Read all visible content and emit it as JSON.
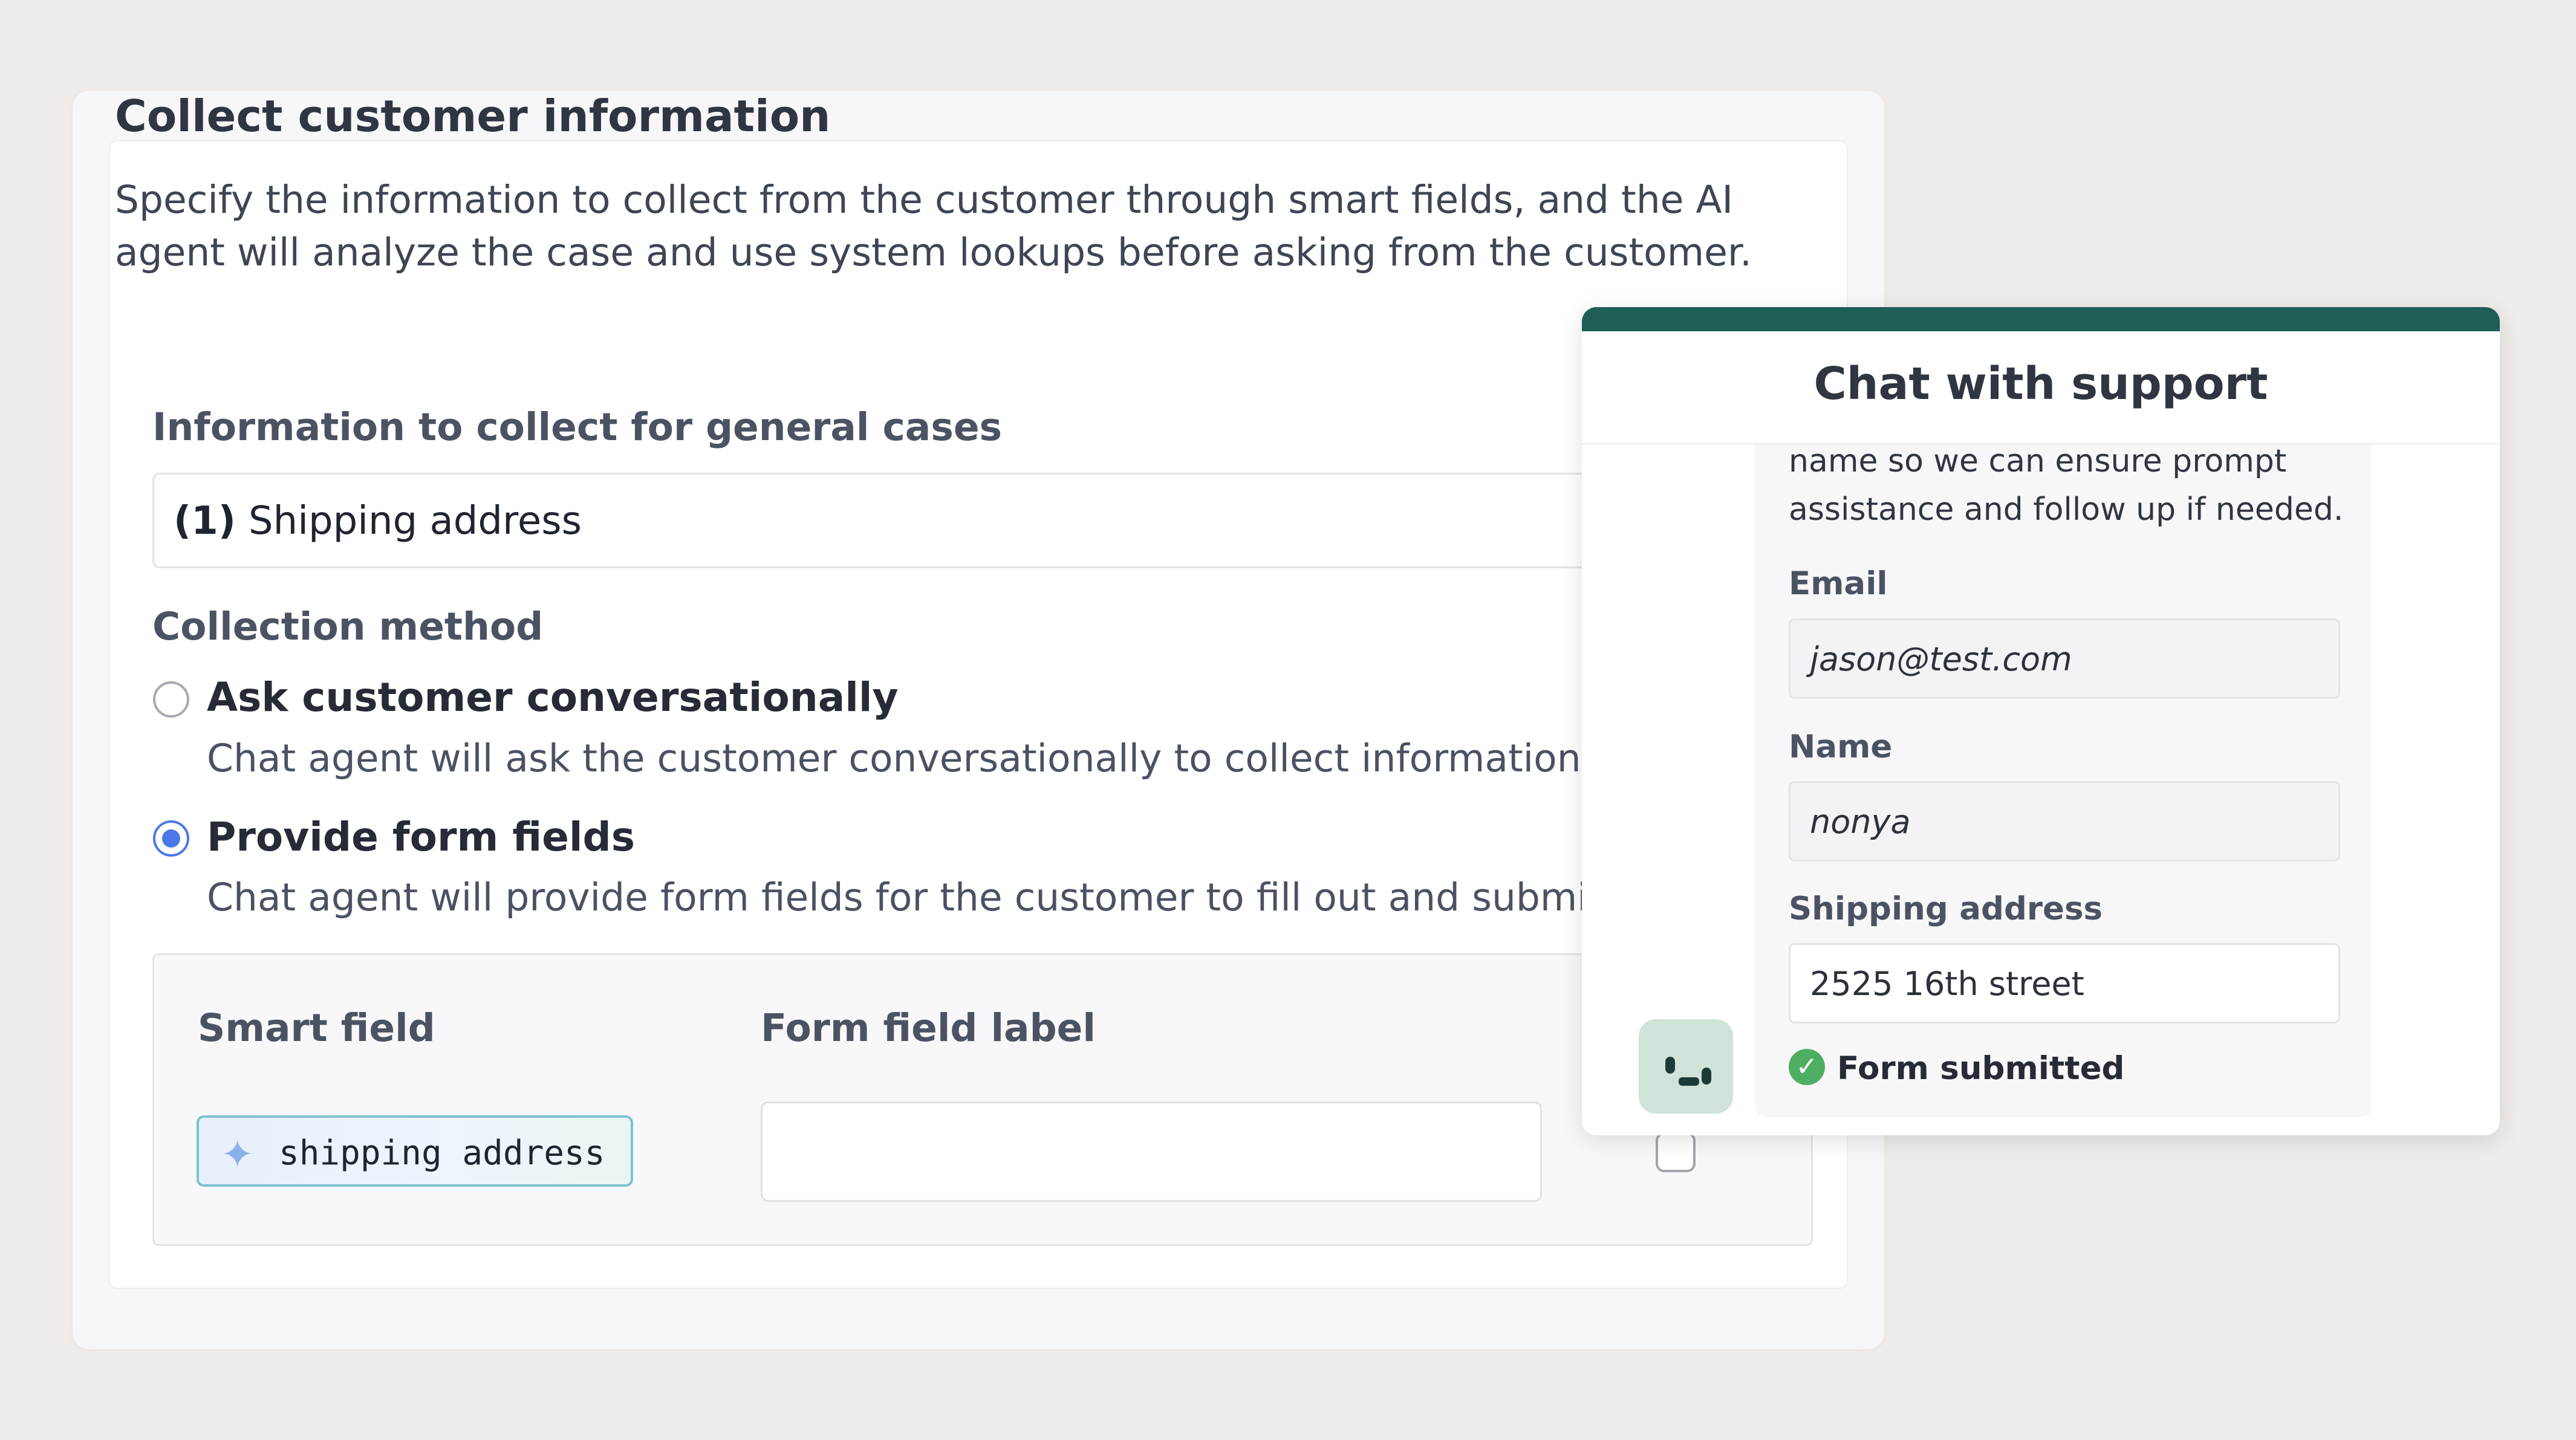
{
  "config": {
    "title": "Collect customer information",
    "description": "Specify the information to collect from the customer through smart fields, and the AI agent will analyze the case and use system lookups before asking from the customer.",
    "section_general": "Information to collect for general cases",
    "dropdown": {
      "index": "(1)",
      "value": "Shipping address"
    },
    "section_method": "Collection method",
    "options": [
      {
        "label": "Ask customer conversationally",
        "desc": "Chat agent will ask the customer conversationally to collect information.",
        "selected": false
      },
      {
        "label": "Provide form fields",
        "desc": "Chat agent will provide form fields for the customer to fill out and submit.",
        "selected": true
      }
    ],
    "table": {
      "col_smart_field": "Smart field",
      "col_form_label": "Form field label",
      "row": {
        "smart_field": "shipping address",
        "form_label": ""
      }
    }
  },
  "chat": {
    "title": "Chat with support",
    "message_lines": [
      "name so we can ensure prompt",
      "assistance and follow up if needed."
    ],
    "fields": [
      {
        "label": "Email",
        "value": "jason@test.com"
      },
      {
        "label": "Name",
        "value": "nonya"
      },
      {
        "label": "Shipping address",
        "value": "2525 16th street"
      }
    ],
    "status": "Form submitted"
  },
  "colors": {
    "accent": "#4a78e8",
    "chat_header": "#1f5d57",
    "success": "#4eae62"
  }
}
